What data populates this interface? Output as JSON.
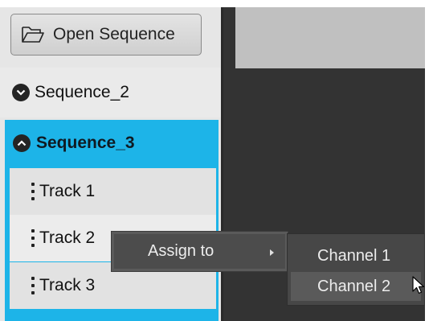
{
  "toolbar": {
    "open_label": "Open Sequence",
    "open_icon": "folder-open-icon"
  },
  "sequences": [
    {
      "label": "Sequence_2",
      "expanded": false,
      "icon": "chevron-down-icon"
    },
    {
      "label": "Sequence_3",
      "expanded": true,
      "icon": "chevron-up-icon",
      "tracks": [
        {
          "label": "Track 1"
        },
        {
          "label": "Track 2"
        },
        {
          "label": "Track 3"
        }
      ]
    }
  ],
  "context_menu": {
    "items": [
      {
        "label": "Assign to",
        "has_submenu": true
      }
    ]
  },
  "submenu": {
    "items": [
      {
        "label": "Channel 1",
        "hovered": false
      },
      {
        "label": "Channel 2",
        "hovered": true
      }
    ]
  },
  "colors": {
    "selection": "#1db4e8",
    "sidebar": "#e6e6e6",
    "dark_area": "#333333",
    "menu": "#4c4c4c"
  }
}
